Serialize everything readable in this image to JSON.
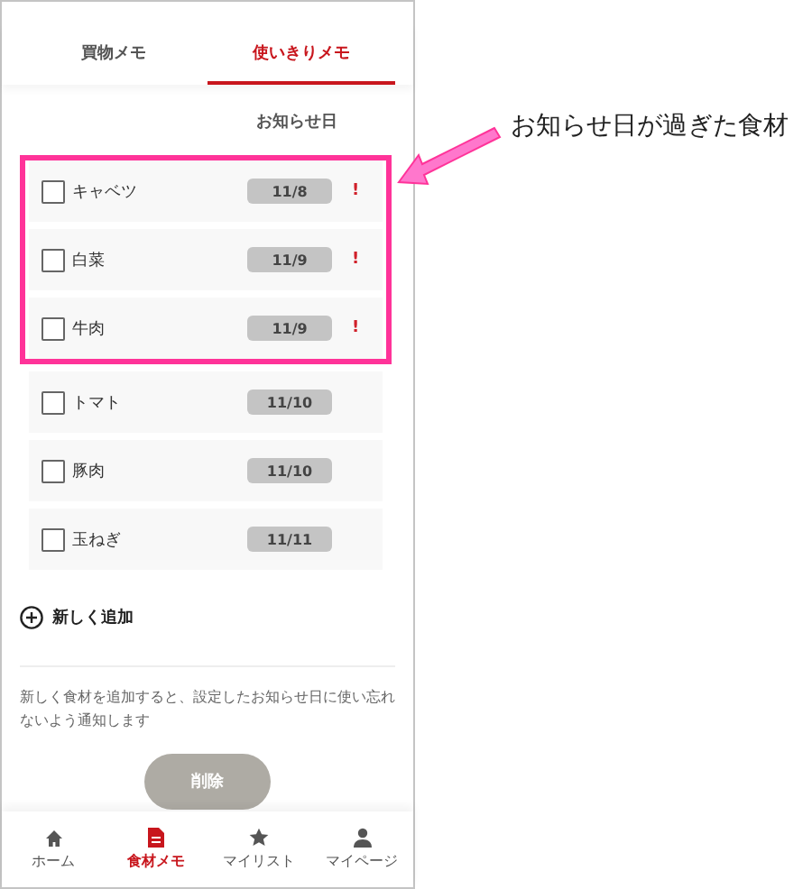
{
  "tabs": [
    {
      "label": "買物メモ",
      "selected": false
    },
    {
      "label": "使いきりメモ",
      "selected": true
    }
  ],
  "column_header": "お知らせ日",
  "items": [
    {
      "name": "キャベツ",
      "date": "11/8",
      "checked": false,
      "overdue": true
    },
    {
      "name": "白菜",
      "date": "11/9",
      "checked": false,
      "overdue": true
    },
    {
      "name": "牛肉",
      "date": "11/9",
      "checked": false,
      "overdue": true
    },
    {
      "name": "トマト",
      "date": "11/10",
      "checked": false,
      "overdue": false
    },
    {
      "name": "豚肉",
      "date": "11/10",
      "checked": false,
      "overdue": false
    },
    {
      "name": "玉ねぎ",
      "date": "11/11",
      "checked": false,
      "overdue": false
    }
  ],
  "overdue_mark": "!",
  "add_button": "新しく追加",
  "note": "新しく食材を追加すると、設定したお知らせ日に使い忘れないよう通知します",
  "delete_button": {
    "label": "削除",
    "disabled": true
  },
  "nav": [
    {
      "label": "ホーム",
      "selected": false
    },
    {
      "label": "食材メモ",
      "selected": true
    },
    {
      "label": "マイリスト",
      "selected": false
    },
    {
      "label": "マイページ",
      "selected": false
    }
  ],
  "annotation": "お知らせ日が過ぎた食材"
}
